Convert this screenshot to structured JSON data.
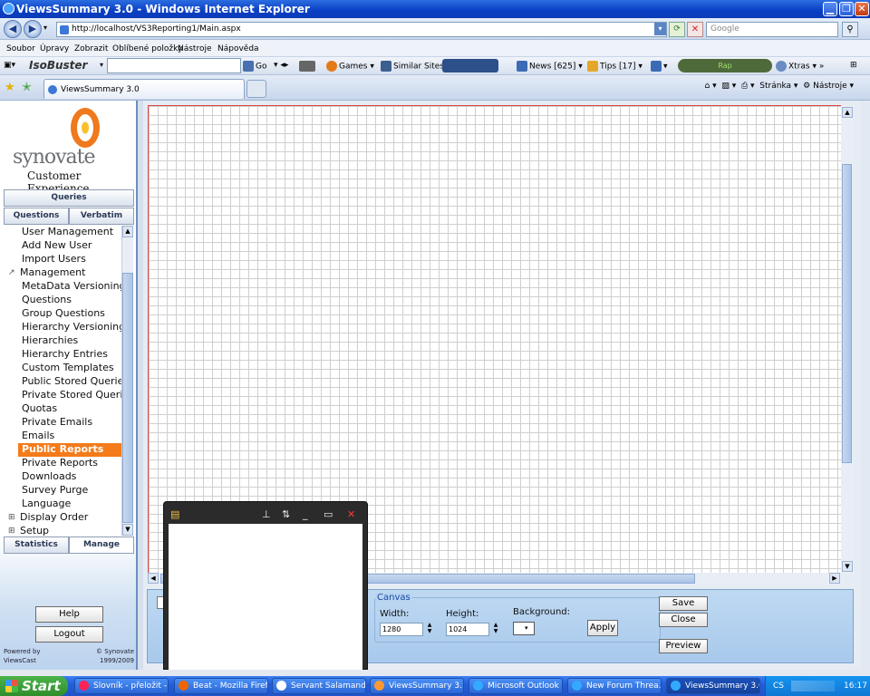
{
  "window": {
    "title": "ViewsSummary 3.0 - Windows Internet Explorer"
  },
  "browser": {
    "address": "http://localhost/VS3Reporting1/Main.aspx",
    "search_placeholder": "Google",
    "menu": [
      "Soubor",
      "Úpravy",
      "Zobrazit",
      "Oblíbené položky",
      "Nástroje",
      "Nápověda"
    ],
    "toolbar": {
      "isobuster": "IsoBuster",
      "go": "Go",
      "games": "Games",
      "similar": "Similar Sites",
      "news": "News [625]",
      "tips": "Tips [17]",
      "rap": "Rap",
      "xtras": "Xtras"
    },
    "tab_title": "ViewsSummary 3.0",
    "cmd": {
      "page": "Stránka",
      "tools": "Nástroje"
    }
  },
  "sidebar": {
    "brand": "synovate",
    "tagline": "Customer Experience",
    "tabs": {
      "queries": "Queries",
      "questions": "Questions",
      "verbatim": "Verbatim",
      "statistics": "Statistics",
      "manage": "Manage"
    },
    "items": [
      {
        "label": "User Management",
        "level": 1
      },
      {
        "label": "Add New User",
        "level": 1
      },
      {
        "label": "Import Users",
        "level": 1
      },
      {
        "label": "Management",
        "level": 0,
        "toggle": "↗"
      },
      {
        "label": "MetaData Versioning",
        "level": 1
      },
      {
        "label": "Questions",
        "level": 1
      },
      {
        "label": "Group Questions",
        "level": 1
      },
      {
        "label": "Hierarchy Versioning",
        "level": 1
      },
      {
        "label": "Hierarchies",
        "level": 1
      },
      {
        "label": "Hierarchy Entries",
        "level": 1
      },
      {
        "label": "Custom Templates",
        "level": 1
      },
      {
        "label": "Public Stored Queries",
        "level": 1
      },
      {
        "label": "Private Stored Queries",
        "level": 1
      },
      {
        "label": "Quotas",
        "level": 1
      },
      {
        "label": "Private Emails",
        "level": 1
      },
      {
        "label": "Emails",
        "level": 1
      },
      {
        "label": "Public Reports",
        "level": 1,
        "selected": true
      },
      {
        "label": "Private Reports",
        "level": 1
      },
      {
        "label": "Downloads",
        "level": 1
      },
      {
        "label": "Survey Purge",
        "level": 1
      },
      {
        "label": "Language",
        "level": 1
      },
      {
        "label": "Display Order",
        "level": 0,
        "toggle": "⊞"
      },
      {
        "label": "Setup",
        "level": 0,
        "toggle": "⊞"
      }
    ],
    "help": "Help",
    "logout": "Logout",
    "powered_by": "Powered by",
    "powered_name": "ViewsCast",
    "copyright": "© Synovate",
    "years": "1999/2009"
  },
  "canvas": {
    "group_label": "Canvas",
    "width_label": "Width:",
    "width_value": "1280",
    "height_label": "Height:",
    "height_value": "1024",
    "background_label": "Background:",
    "apply": "Apply",
    "save": "Save",
    "close": "Close",
    "preview": "Preview"
  },
  "taskbar": {
    "start": "Start",
    "items": [
      "Slovník - přeložit - ...",
      "Beat - Mozilla Firefox",
      "Servant Salamander",
      "ViewsSummary 3....",
      "Microsoft Outlook ...",
      "New Forum Threa...",
      "ViewsSummary 3.0..."
    ],
    "lang": "CS",
    "clock": "16:17"
  },
  "colors": {
    "selected": "#f47b1a",
    "accent": "#245edb"
  }
}
